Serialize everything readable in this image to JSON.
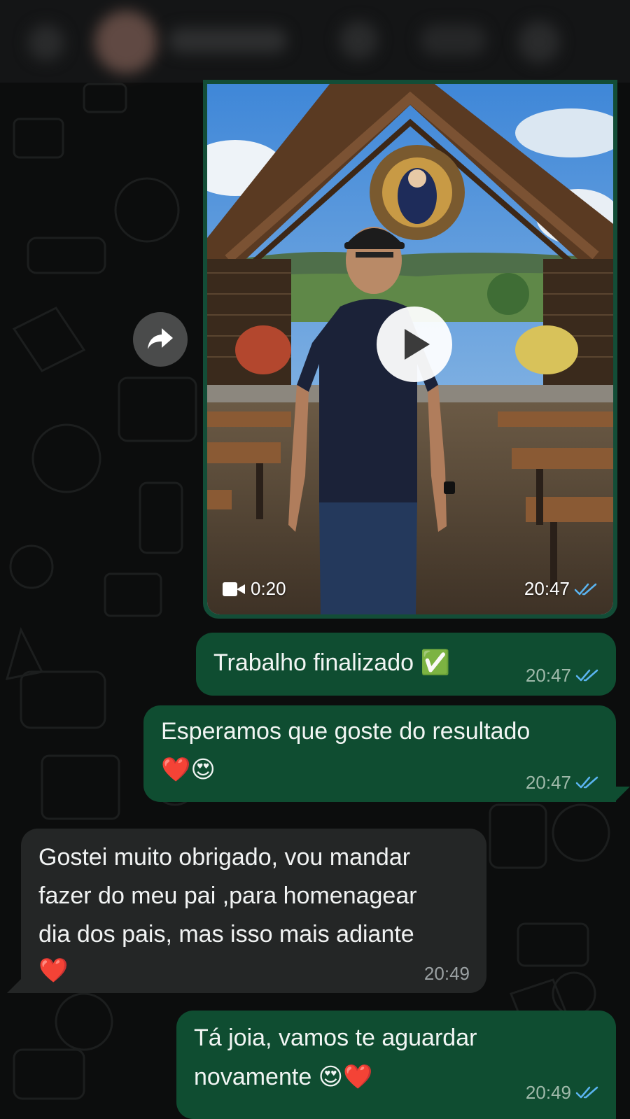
{
  "header": {
    "back_icon": "back-icon (blurred)",
    "avatar": "contact-avatar (blurred)",
    "contact_name": "",
    "video_call_icon": "video-call-icon (blurred)",
    "call_icon": "phone-icon (blurred)"
  },
  "video_message": {
    "duration": "0:20",
    "time": "20:47",
    "status": "read",
    "play_icon": "play-icon",
    "camera_icon": "video-camera-icon"
  },
  "forward": {
    "icon": "forward-arrow-icon"
  },
  "messages": [
    {
      "direction": "outgoing",
      "lines": [
        "Trabalho finalizado ✅"
      ],
      "time": "20:47",
      "status": "read"
    },
    {
      "direction": "outgoing",
      "lines": [
        "Esperamos que goste do resultado",
        "❤️😍"
      ],
      "time": "20:47",
      "status": "read"
    },
    {
      "direction": "incoming",
      "lines": [
        "Gostei muito obrigado, vou mandar",
        "fazer do meu pai ,para homenagear",
        "dia dos pais, mas isso mais adiante",
        "❤️"
      ],
      "time": "20:49"
    },
    {
      "direction": "outgoing",
      "lines": [
        "Tá joia, vamos te aguardar",
        "novamente 😍❤️"
      ],
      "time": "20:49",
      "status": "read"
    }
  ],
  "colors": {
    "outgoing_bubble": "#0f4d31",
    "incoming_bubble": "#242626",
    "read_ticks": "#5ab4f0",
    "chat_background": "#0c0d0d"
  }
}
